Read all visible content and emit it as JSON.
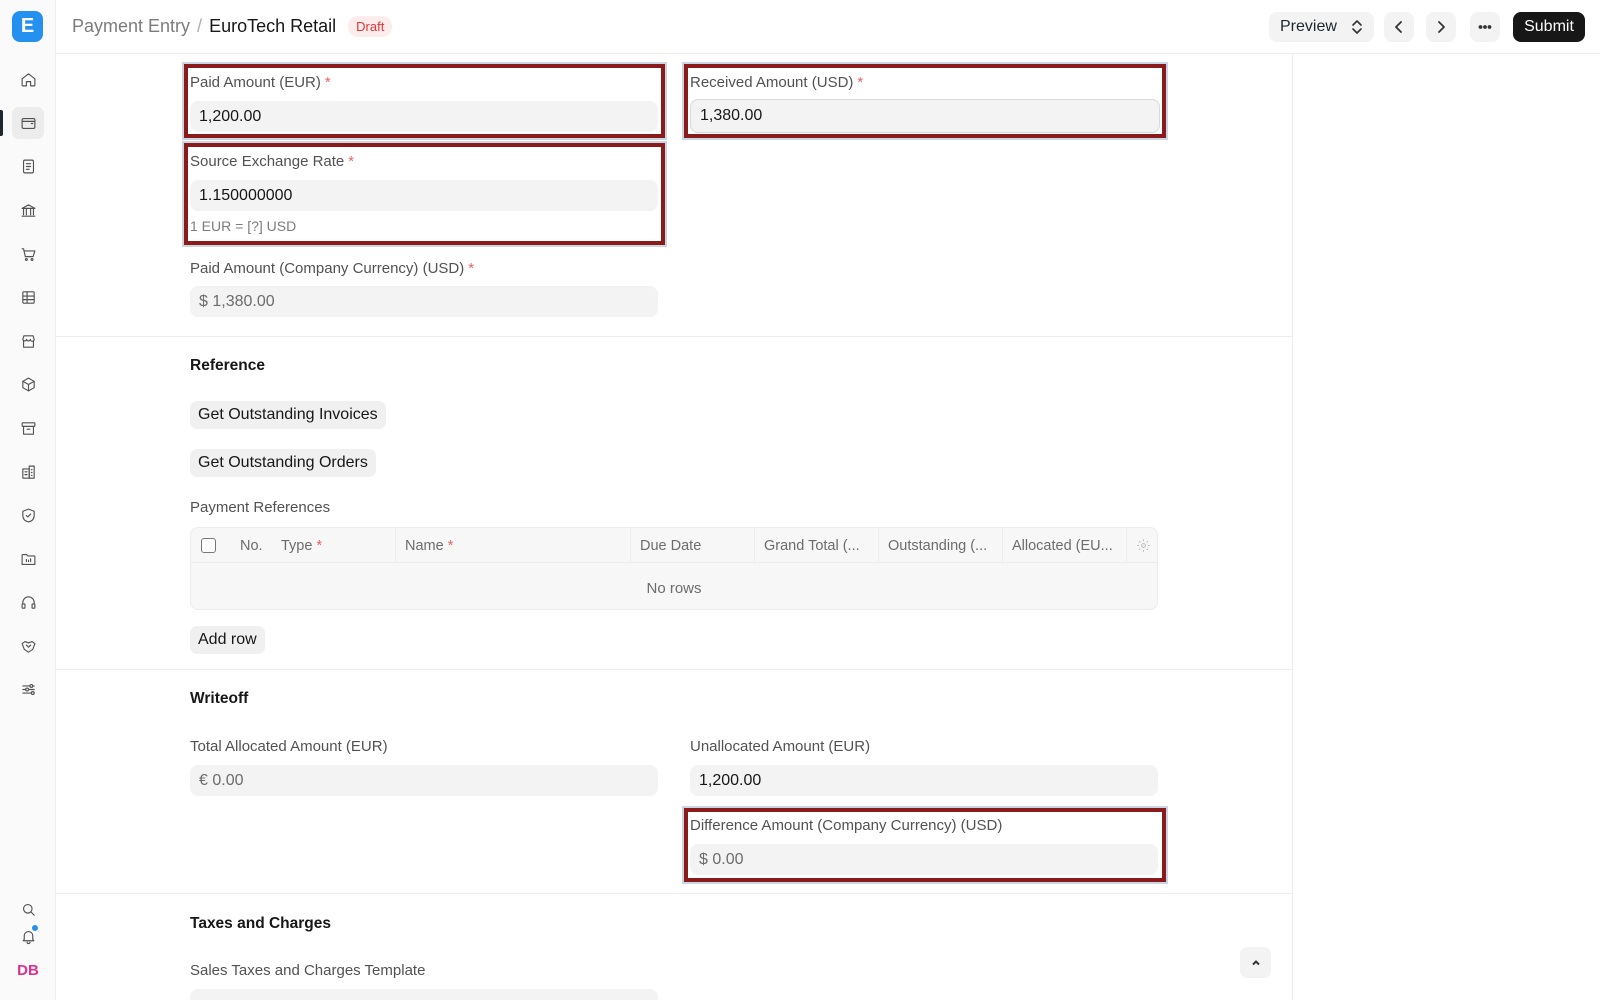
{
  "app": {
    "logo_letter": "E"
  },
  "breadcrumb": {
    "parent": "Payment Entry",
    "separator": "/",
    "current": "EuroTech Retail",
    "status": "Draft"
  },
  "toolbar": {
    "preview_label": "Preview",
    "submit_label": "Submit"
  },
  "sidebar": {
    "items": [
      {
        "icon": "home-icon"
      },
      {
        "icon": "wallet-icon"
      },
      {
        "icon": "document-icon"
      },
      {
        "icon": "bank-icon"
      },
      {
        "icon": "cart-icon"
      },
      {
        "icon": "table-icon"
      },
      {
        "icon": "store-icon"
      },
      {
        "icon": "box-icon"
      },
      {
        "icon": "archive-icon"
      },
      {
        "icon": "building-icon"
      },
      {
        "icon": "shield-icon"
      },
      {
        "icon": "folder-icon"
      },
      {
        "icon": "headset-icon"
      },
      {
        "icon": "handshake-icon"
      },
      {
        "icon": "sliders-icon"
      }
    ],
    "search_icon": "search-icon",
    "notification_icon": "bell-icon",
    "avatar_initials": "DB"
  },
  "amounts": {
    "paid_amount_label": "Paid Amount (EUR)",
    "paid_amount_value": "1,200.00",
    "received_amount_label": "Received Amount (USD)",
    "received_amount_value": "1,380.00",
    "source_exchange_rate_label": "Source Exchange Rate",
    "source_exchange_rate_value": "1.150000000",
    "source_exchange_rate_help": "1 EUR = [?] USD",
    "paid_company_label": "Paid Amount (Company Currency) (USD)",
    "paid_company_value": "$ 1,380.00",
    "required_mark": "*"
  },
  "reference": {
    "title": "Reference",
    "get_invoices_label": "Get Outstanding Invoices",
    "get_orders_label": "Get Outstanding Orders",
    "table_label": "Payment References",
    "columns": [
      "No.",
      "Type",
      "Name",
      "Due Date",
      "Grand Total (...",
      "Outstanding (...",
      "Allocated (EU..."
    ],
    "empty_text": "No rows",
    "add_row_label": "Add row"
  },
  "writeoff": {
    "title": "Writeoff",
    "total_allocated_label": "Total Allocated Amount (EUR)",
    "total_allocated_value": "€ 0.00",
    "unallocated_label": "Unallocated Amount (EUR)",
    "unallocated_value": "1,200.00",
    "difference_label": "Difference Amount (Company Currency) (USD)",
    "difference_value": "$ 0.00"
  },
  "taxes": {
    "title": "Taxes and Charges",
    "template_label": "Sales Taxes and Charges Template"
  },
  "colors": {
    "accent": "#2490ef",
    "highlight": "#8b1a1a",
    "draft_badge": "#e03636"
  }
}
